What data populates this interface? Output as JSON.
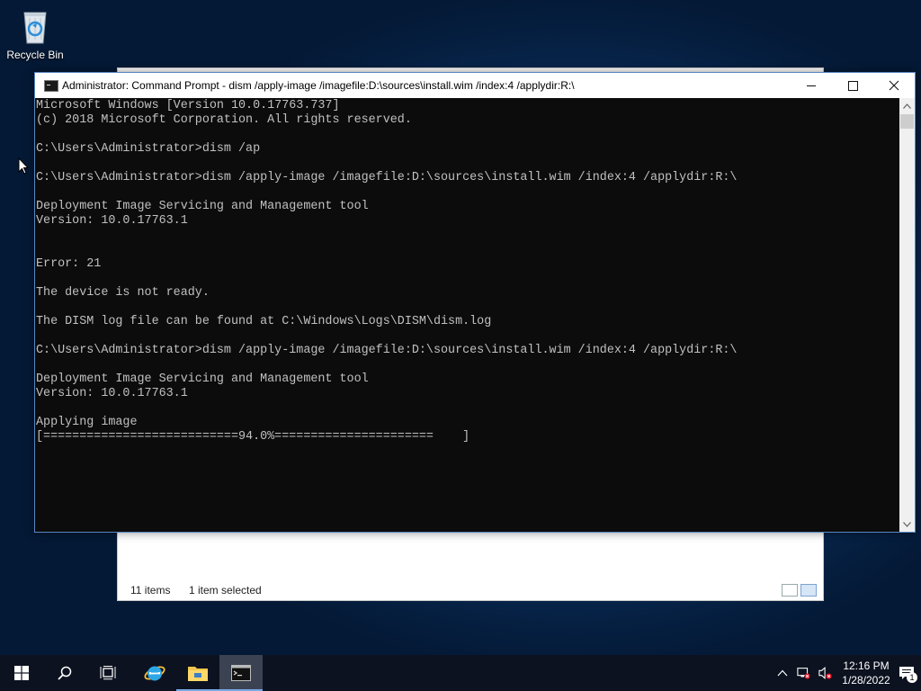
{
  "desktop": {
    "recycle_bin_label": "Recycle Bin"
  },
  "explorer": {
    "status_items": "11 items",
    "status_selected": "1 item selected"
  },
  "console": {
    "title": "Administrator: Command Prompt - dism  /apply-image /imagefile:D:\\sources\\install.wim /index:4 /applydir:R:\\",
    "lines": [
      "Microsoft Windows [Version 10.0.17763.737]",
      "(c) 2018 Microsoft Corporation. All rights reserved.",
      "",
      "C:\\Users\\Administrator>dism /ap",
      "",
      "C:\\Users\\Administrator>dism /apply-image /imagefile:D:\\sources\\install.wim /index:4 /applydir:R:\\",
      "",
      "Deployment Image Servicing and Management tool",
      "Version: 10.0.17763.1",
      "",
      "",
      "Error: 21",
      "",
      "The device is not ready.",
      "",
      "The DISM log file can be found at C:\\Windows\\Logs\\DISM\\dism.log",
      "",
      "C:\\Users\\Administrator>dism /apply-image /imagefile:D:\\sources\\install.wim /index:4 /applydir:R:\\",
      "",
      "Deployment Image Servicing and Management tool",
      "Version: 10.0.17763.1",
      "",
      "Applying image",
      "[===========================94.0%======================    ]"
    ],
    "colors": {
      "background": "#0c0c0c",
      "text": "#c0c0c0"
    }
  },
  "taskbar": {
    "start_icon": "windows-logo-icon",
    "search_icon": "search-icon",
    "task_view_icon": "task-view-icon",
    "apps": [
      "internet-explorer-icon",
      "file-explorer-icon",
      "command-prompt-icon"
    ],
    "clock_time": "12:16 PM",
    "clock_date": "1/28/2022",
    "notification_count": "1",
    "accent_color": "#77a8e6"
  }
}
